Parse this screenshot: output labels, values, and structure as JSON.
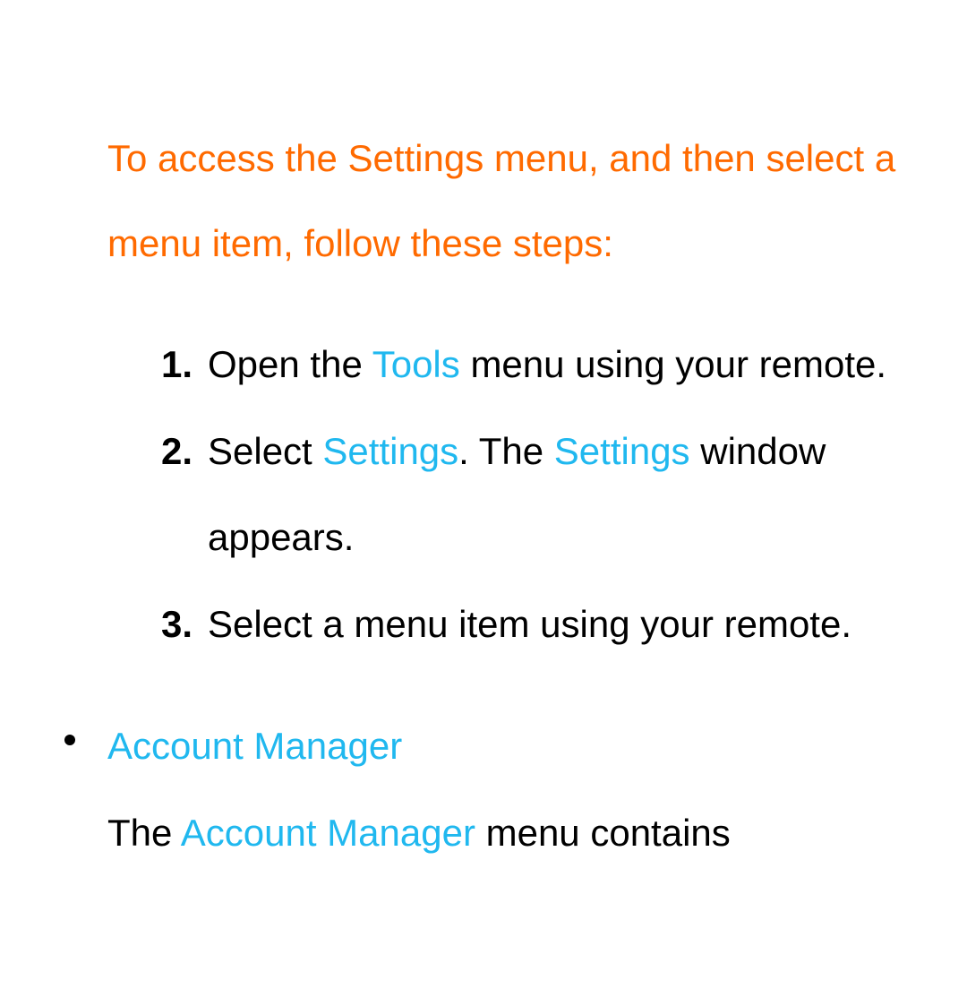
{
  "intro": "To access the Settings menu, and then select a menu item, follow these steps:",
  "steps": [
    {
      "pre": "Open the ",
      "hl1": "Tools",
      "post": " menu using your remote."
    },
    {
      "pre": "Select ",
      "hl1": "Settings",
      "mid": ". The ",
      "hl2": "Settings",
      "post": " window appears."
    },
    {
      "pre": "Select a menu item using your remote."
    }
  ],
  "bullet": {
    "title": "Account Manager",
    "body_pre": "The ",
    "body_hl": "Account Manager",
    "body_post": " menu contains"
  }
}
